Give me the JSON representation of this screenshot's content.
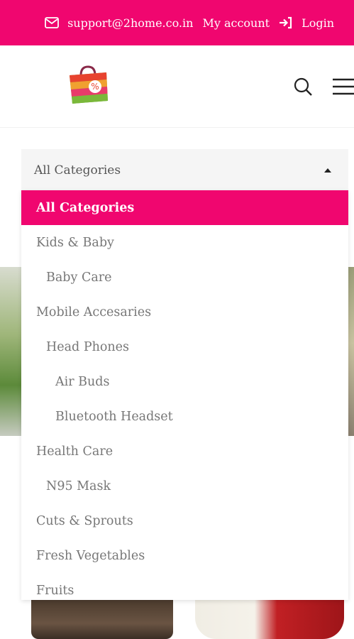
{
  "topbar": {
    "email": "support@2home.co.in",
    "account": "My account",
    "login": "Login"
  },
  "header": {
    "logo_icon": "shopping-bag-logo",
    "search_icon": "search-icon",
    "menu_icon": "hamburger-menu-icon"
  },
  "colors": {
    "brand": "#f0066f",
    "select_bg": "#f5f5f5",
    "option_text": "#777777"
  },
  "category_select": {
    "selected_value": "All Categories",
    "options": [
      {
        "label": "All Categories",
        "level": 0,
        "selected": true
      },
      {
        "label": "Kids & Baby",
        "level": 0
      },
      {
        "label": "Baby Care",
        "level": 1
      },
      {
        "label": "Mobile Accesaries",
        "level": 0
      },
      {
        "label": "Head Phones",
        "level": 1
      },
      {
        "label": "Air Buds",
        "level": 2
      },
      {
        "label": "Bluetooth Headset",
        "level": 2
      },
      {
        "label": "Health Care",
        "level": 0
      },
      {
        "label": "N95 Mask",
        "level": 1
      },
      {
        "label": "Cuts & Sprouts",
        "level": 0
      },
      {
        "label": "Fresh Vegetables",
        "level": 0
      },
      {
        "label": "Fruits",
        "level": 0
      }
    ]
  }
}
